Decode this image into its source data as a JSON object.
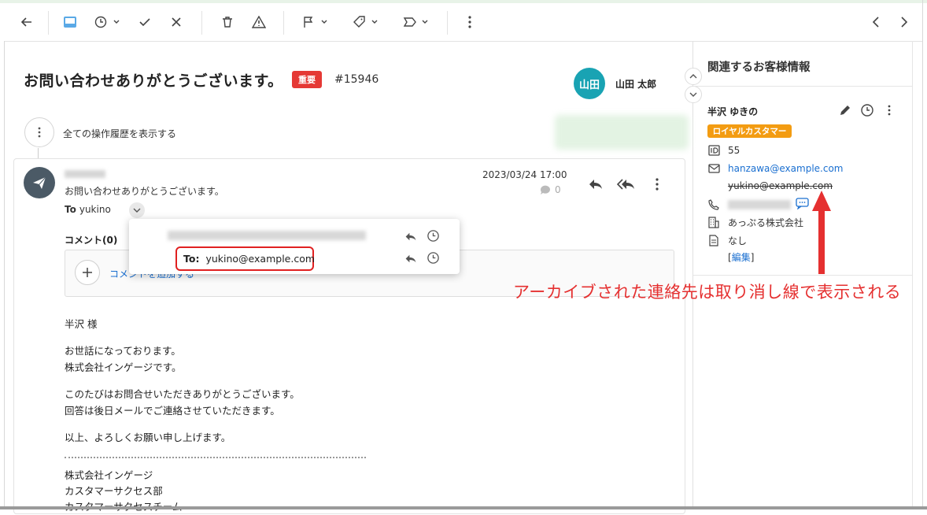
{
  "toolbar": {
    "buttons": [
      "back",
      "inbox",
      "snooze",
      "done",
      "close",
      "delete",
      "spam",
      "flag",
      "tag",
      "label",
      "more"
    ],
    "nav": [
      "prev",
      "next"
    ]
  },
  "ticket": {
    "title": "お問い合わせありがとうございます。",
    "priority_badge": "重要",
    "number": "#15946",
    "assignee_initials": "山田",
    "assignee_name": "山田 太郎"
  },
  "history": {
    "label": "全ての操作履歴を表示する"
  },
  "message": {
    "subject": "お問い合わせありがとうございます。",
    "to_label": "To",
    "to_value": "yukino",
    "date": "2023/03/24 17:00",
    "comment_count": "0",
    "comments_heading": "コメント(0)",
    "comment_placeholder": "コメントを追加する",
    "body": [
      "半沢 様",
      "お世話になっております。",
      "株式会社インゲージです。",
      "このたびはお問合せいただきありがとうございます。",
      "回答は後日メールでご連絡させていただきます。",
      "以上、よろしくお願い申し上げます。"
    ],
    "signature": [
      "株式会社インゲージ",
      "カスタマーサクセス部",
      "カスタマーサクセスチーム"
    ]
  },
  "recipient_popup": {
    "to_label": "To:",
    "to_value": "yukino@example.com"
  },
  "sidebar": {
    "title": "関連するお客様情報",
    "customer_name": "半沢 ゆきの",
    "tag": "ロイヤルカスタマー",
    "id": "55",
    "email_active": "hanzawa@example.com",
    "email_archived": "yukino@example.com",
    "company": "あっぷる株式会社",
    "note": "なし",
    "edit_open": "[",
    "edit_label": "編集",
    "edit_close": "]"
  },
  "annotation": {
    "text": "アーカイブされた連絡先は取り消し線で表示される",
    "color": "#e53030"
  },
  "colors": {
    "accent": "#1a6fd0",
    "badge_red": "#e53935",
    "avatar_teal": "#19a3b3",
    "loyal_orange": "#f39c12"
  }
}
